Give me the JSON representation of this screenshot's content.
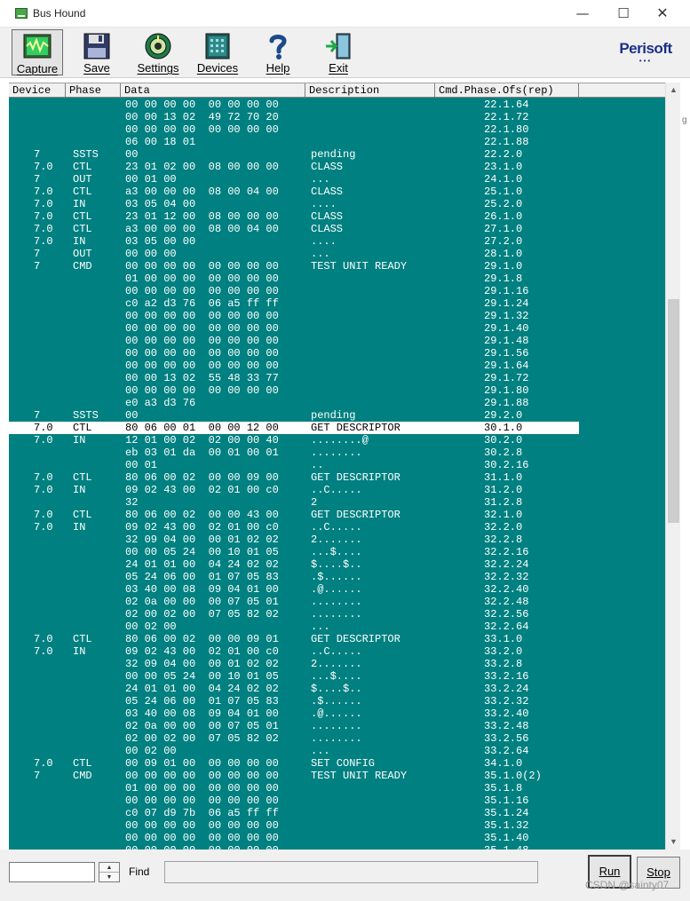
{
  "window": {
    "title": "Bus Hound",
    "minimize": "—",
    "maximize": "☐",
    "close": "✕"
  },
  "toolbar": {
    "capture": "Capture",
    "save": "Save",
    "settings": "Settings",
    "devices": "Devices",
    "help": "Help",
    "exit": "Exit"
  },
  "logo": {
    "text": "Perisoft",
    "dots": "•••"
  },
  "columns": [
    "Device",
    "Phase",
    "Data",
    "Description",
    "Cmd.Phase.Ofs(rep)"
  ],
  "rows": [
    {
      "dev": "",
      "phase": "",
      "data": "00 00 00 00  00 00 00 00",
      "desc": "",
      "ofs": "22.1.64"
    },
    {
      "dev": "",
      "phase": "",
      "data": "00 00 13 02  49 72 70 20",
      "desc": "",
      "ofs": "22.1.72"
    },
    {
      "dev": "",
      "phase": "",
      "data": "00 00 00 00  00 00 00 00",
      "desc": "",
      "ofs": "22.1.80"
    },
    {
      "dev": "",
      "phase": "",
      "data": "06 00 18 01",
      "desc": "",
      "ofs": "22.1.88"
    },
    {
      "dev": "7",
      "phase": "SSTS",
      "data": "00",
      "desc": "pending",
      "ofs": "22.2.0"
    },
    {
      "dev": "7.0",
      "phase": "CTL",
      "data": "23 01 02 00  08 00 00 00",
      "desc": "CLASS",
      "ofs": "23.1.0"
    },
    {
      "dev": "7",
      "phase": "OUT",
      "data": "00 01 00",
      "desc": "...",
      "ofs": "24.1.0"
    },
    {
      "dev": "7.0",
      "phase": "CTL",
      "data": "a3 00 00 00  08 00 04 00",
      "desc": "CLASS",
      "ofs": "25.1.0"
    },
    {
      "dev": "7.0",
      "phase": "IN",
      "data": "03 05 04 00",
      "desc": "....",
      "ofs": "25.2.0"
    },
    {
      "dev": "7.0",
      "phase": "CTL",
      "data": "23 01 12 00  08 00 00 00",
      "desc": "CLASS",
      "ofs": "26.1.0"
    },
    {
      "dev": "7.0",
      "phase": "CTL",
      "data": "a3 00 00 00  08 00 04 00",
      "desc": "CLASS",
      "ofs": "27.1.0"
    },
    {
      "dev": "7.0",
      "phase": "IN",
      "data": "03 05 00 00",
      "desc": "....",
      "ofs": "27.2.0"
    },
    {
      "dev": "7",
      "phase": "OUT",
      "data": "00 00 00",
      "desc": "...",
      "ofs": "28.1.0"
    },
    {
      "dev": "7",
      "phase": "CMD",
      "data": "00 00 00 00  00 00 00 00",
      "desc": "TEST UNIT READY",
      "ofs": "29.1.0"
    },
    {
      "dev": "",
      "phase": "",
      "data": "01 00 00 00  00 00 00 00",
      "desc": "",
      "ofs": "29.1.8"
    },
    {
      "dev": "",
      "phase": "",
      "data": "00 00 00 00  00 00 00 00",
      "desc": "",
      "ofs": "29.1.16"
    },
    {
      "dev": "",
      "phase": "",
      "data": "c0 a2 d3 76  06 a5 ff ff",
      "desc": "",
      "ofs": "29.1.24"
    },
    {
      "dev": "",
      "phase": "",
      "data": "00 00 00 00  00 00 00 00",
      "desc": "",
      "ofs": "29.1.32"
    },
    {
      "dev": "",
      "phase": "",
      "data": "00 00 00 00  00 00 00 00",
      "desc": "",
      "ofs": "29.1.40"
    },
    {
      "dev": "",
      "phase": "",
      "data": "00 00 00 00  00 00 00 00",
      "desc": "",
      "ofs": "29.1.48"
    },
    {
      "dev": "",
      "phase": "",
      "data": "00 00 00 00  00 00 00 00",
      "desc": "",
      "ofs": "29.1.56"
    },
    {
      "dev": "",
      "phase": "",
      "data": "00 00 00 00  00 00 00 00",
      "desc": "",
      "ofs": "29.1.64"
    },
    {
      "dev": "",
      "phase": "",
      "data": "00 00 13 02  55 48 33 77",
      "desc": "",
      "ofs": "29.1.72"
    },
    {
      "dev": "",
      "phase": "",
      "data": "00 00 00 00  00 00 00 00",
      "desc": "",
      "ofs": "29.1.80"
    },
    {
      "dev": "",
      "phase": "",
      "data": "e0 a3 d3 76",
      "desc": "",
      "ofs": "29.1.88"
    },
    {
      "dev": "7",
      "phase": "SSTS",
      "data": "00",
      "desc": "pending",
      "ofs": "29.2.0"
    },
    {
      "dev": "7.0",
      "phase": "CTL",
      "data": "80 06 00 01  00 00 12 00",
      "desc": "GET DESCRIPTOR",
      "ofs": "30.1.0",
      "selected": true
    },
    {
      "dev": "7.0",
      "phase": "IN",
      "data": "12 01 00 02  02 00 00 40",
      "desc": "........@",
      "ofs": "30.2.0"
    },
    {
      "dev": "",
      "phase": "",
      "data": "eb 03 01 da  00 01 00 01",
      "desc": "........",
      "ofs": "30.2.8"
    },
    {
      "dev": "",
      "phase": "",
      "data": "00 01",
      "desc": "..",
      "ofs": "30.2.16"
    },
    {
      "dev": "7.0",
      "phase": "CTL",
      "data": "80 06 00 02  00 00 09 00",
      "desc": "GET DESCRIPTOR",
      "ofs": "31.1.0"
    },
    {
      "dev": "7.0",
      "phase": "IN",
      "data": "09 02 43 00  02 01 00 c0",
      "desc": "..C.....",
      "ofs": "31.2.0"
    },
    {
      "dev": "",
      "phase": "",
      "data": "32",
      "desc": "2",
      "ofs": "31.2.8"
    },
    {
      "dev": "7.0",
      "phase": "CTL",
      "data": "80 06 00 02  00 00 43 00",
      "desc": "GET DESCRIPTOR",
      "ofs": "32.1.0"
    },
    {
      "dev": "7.0",
      "phase": "IN",
      "data": "09 02 43 00  02 01 00 c0",
      "desc": "..C.....",
      "ofs": "32.2.0"
    },
    {
      "dev": "",
      "phase": "",
      "data": "32 09 04 00  00 01 02 02",
      "desc": "2.......",
      "ofs": "32.2.8"
    },
    {
      "dev": "",
      "phase": "",
      "data": "00 00 05 24  00 10 01 05",
      "desc": "...$....",
      "ofs": "32.2.16"
    },
    {
      "dev": "",
      "phase": "",
      "data": "24 01 01 00  04 24 02 02",
      "desc": "$....$..",
      "ofs": "32.2.24"
    },
    {
      "dev": "",
      "phase": "",
      "data": "05 24 06 00  01 07 05 83",
      "desc": ".$......",
      "ofs": "32.2.32"
    },
    {
      "dev": "",
      "phase": "",
      "data": "03 40 00 08  09 04 01 00",
      "desc": ".@......",
      "ofs": "32.2.40"
    },
    {
      "dev": "",
      "phase": "",
      "data": "02 0a 00 00  00 07 05 01",
      "desc": "........",
      "ofs": "32.2.48"
    },
    {
      "dev": "",
      "phase": "",
      "data": "02 00 02 00  07 05 82 02",
      "desc": "........",
      "ofs": "32.2.56"
    },
    {
      "dev": "",
      "phase": "",
      "data": "00 02 00",
      "desc": "...",
      "ofs": "32.2.64"
    },
    {
      "dev": "7.0",
      "phase": "CTL",
      "data": "80 06 00 02  00 00 09 01",
      "desc": "GET DESCRIPTOR",
      "ofs": "33.1.0"
    },
    {
      "dev": "7.0",
      "phase": "IN",
      "data": "09 02 43 00  02 01 00 c0",
      "desc": "..C.....",
      "ofs": "33.2.0"
    },
    {
      "dev": "",
      "phase": "",
      "data": "32 09 04 00  00 01 02 02",
      "desc": "2.......",
      "ofs": "33.2.8"
    },
    {
      "dev": "",
      "phase": "",
      "data": "00 00 05 24  00 10 01 05",
      "desc": "...$....",
      "ofs": "33.2.16"
    },
    {
      "dev": "",
      "phase": "",
      "data": "24 01 01 00  04 24 02 02",
      "desc": "$....$..",
      "ofs": "33.2.24"
    },
    {
      "dev": "",
      "phase": "",
      "data": "05 24 06 00  01 07 05 83",
      "desc": ".$......",
      "ofs": "33.2.32"
    },
    {
      "dev": "",
      "phase": "",
      "data": "03 40 00 08  09 04 01 00",
      "desc": ".@......",
      "ofs": "33.2.40"
    },
    {
      "dev": "",
      "phase": "",
      "data": "02 0a 00 00  00 07 05 01",
      "desc": "........",
      "ofs": "33.2.48"
    },
    {
      "dev": "",
      "phase": "",
      "data": "02 00 02 00  07 05 82 02",
      "desc": "........",
      "ofs": "33.2.56"
    },
    {
      "dev": "",
      "phase": "",
      "data": "00 02 00",
      "desc": "...",
      "ofs": "33.2.64"
    },
    {
      "dev": "7.0",
      "phase": "CTL",
      "data": "00 09 01 00  00 00 00 00",
      "desc": "SET CONFIG",
      "ofs": "34.1.0"
    },
    {
      "dev": "7",
      "phase": "CMD",
      "data": "00 00 00 00  00 00 00 00",
      "desc": "TEST UNIT READY",
      "ofs": "35.1.0(2)"
    },
    {
      "dev": "",
      "phase": "",
      "data": "01 00 00 00  00 00 00 00",
      "desc": "",
      "ofs": "35.1.8"
    },
    {
      "dev": "",
      "phase": "",
      "data": "00 00 00 00  00 00 00 00",
      "desc": "",
      "ofs": "35.1.16"
    },
    {
      "dev": "",
      "phase": "",
      "data": "c0 07 d9 7b  06 a5 ff ff",
      "desc": "",
      "ofs": "35.1.24"
    },
    {
      "dev": "",
      "phase": "",
      "data": "00 00 00 00  00 00 00 00",
      "desc": "",
      "ofs": "35.1.32"
    },
    {
      "dev": "",
      "phase": "",
      "data": "00 00 00 00  00 00 00 00",
      "desc": "",
      "ofs": "35.1.40"
    },
    {
      "dev": "",
      "phase": "",
      "data": "00 00 00 00  00 00 00 00",
      "desc": "",
      "ofs": "35.1.48"
    }
  ],
  "bottom": {
    "find_value": "",
    "find_label": "Find",
    "status": "",
    "run": "Run",
    "stop": "Stop",
    "spin_up": "▲",
    "spin_down": "▼"
  },
  "scroll": {
    "up": "▲",
    "down": "▼"
  },
  "watermark": "CSDN @sainty07",
  "side_text": "g"
}
